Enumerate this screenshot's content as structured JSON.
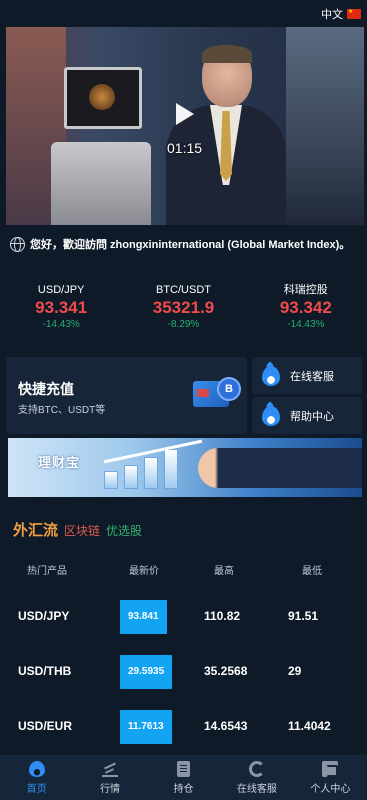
{
  "topbar": {
    "language": "中文"
  },
  "video": {
    "time": "01:15"
  },
  "notice": {
    "text": "您好，歡迎訪問 zhongxininternational (Global Market Index)。"
  },
  "tickers": [
    {
      "name": "USD/JPY",
      "price": "93.341",
      "change": "-14.43%"
    },
    {
      "name": "BTC/USDT",
      "price": "35321.9",
      "change": "-8.29%"
    },
    {
      "name": "科瑞控股",
      "price": "93.342",
      "change": "-14.43%"
    }
  ],
  "recharge": {
    "title": "快捷充值",
    "subtitle": "支持BTC、USDT等",
    "coin_symbol": "B"
  },
  "side_buttons": {
    "service": "在线客服",
    "help": "帮助中心"
  },
  "banner": {
    "text": "理财宝"
  },
  "tabs": {
    "forex": "外汇流",
    "blockchain": "区块链",
    "stocks": "优选股"
  },
  "table": {
    "headers": {
      "product": "热门产品",
      "last": "最新价",
      "high": "最高",
      "low": "最低"
    },
    "rows": [
      {
        "symbol": "USD/JPY",
        "last": "93.841",
        "high": "110.82",
        "low": "91.51"
      },
      {
        "symbol": "USD/THB",
        "last": "29.5935",
        "high": "35.2568",
        "low": "29"
      },
      {
        "symbol": "USD/EUR",
        "last": "11.7613",
        "high": "14.6543",
        "low": "11.4042"
      }
    ]
  },
  "tabbar": {
    "home": "首页",
    "market": "行情",
    "positions": "持仓",
    "service": "在线客服",
    "profile": "个人中心"
  },
  "colors": {
    "background": "#0f1a29",
    "panel": "#172538",
    "down_red": "#f04a4a",
    "change_green": "#23b26d",
    "accent_blue": "#2f8ef5",
    "price_badge": "#12a3f2"
  }
}
